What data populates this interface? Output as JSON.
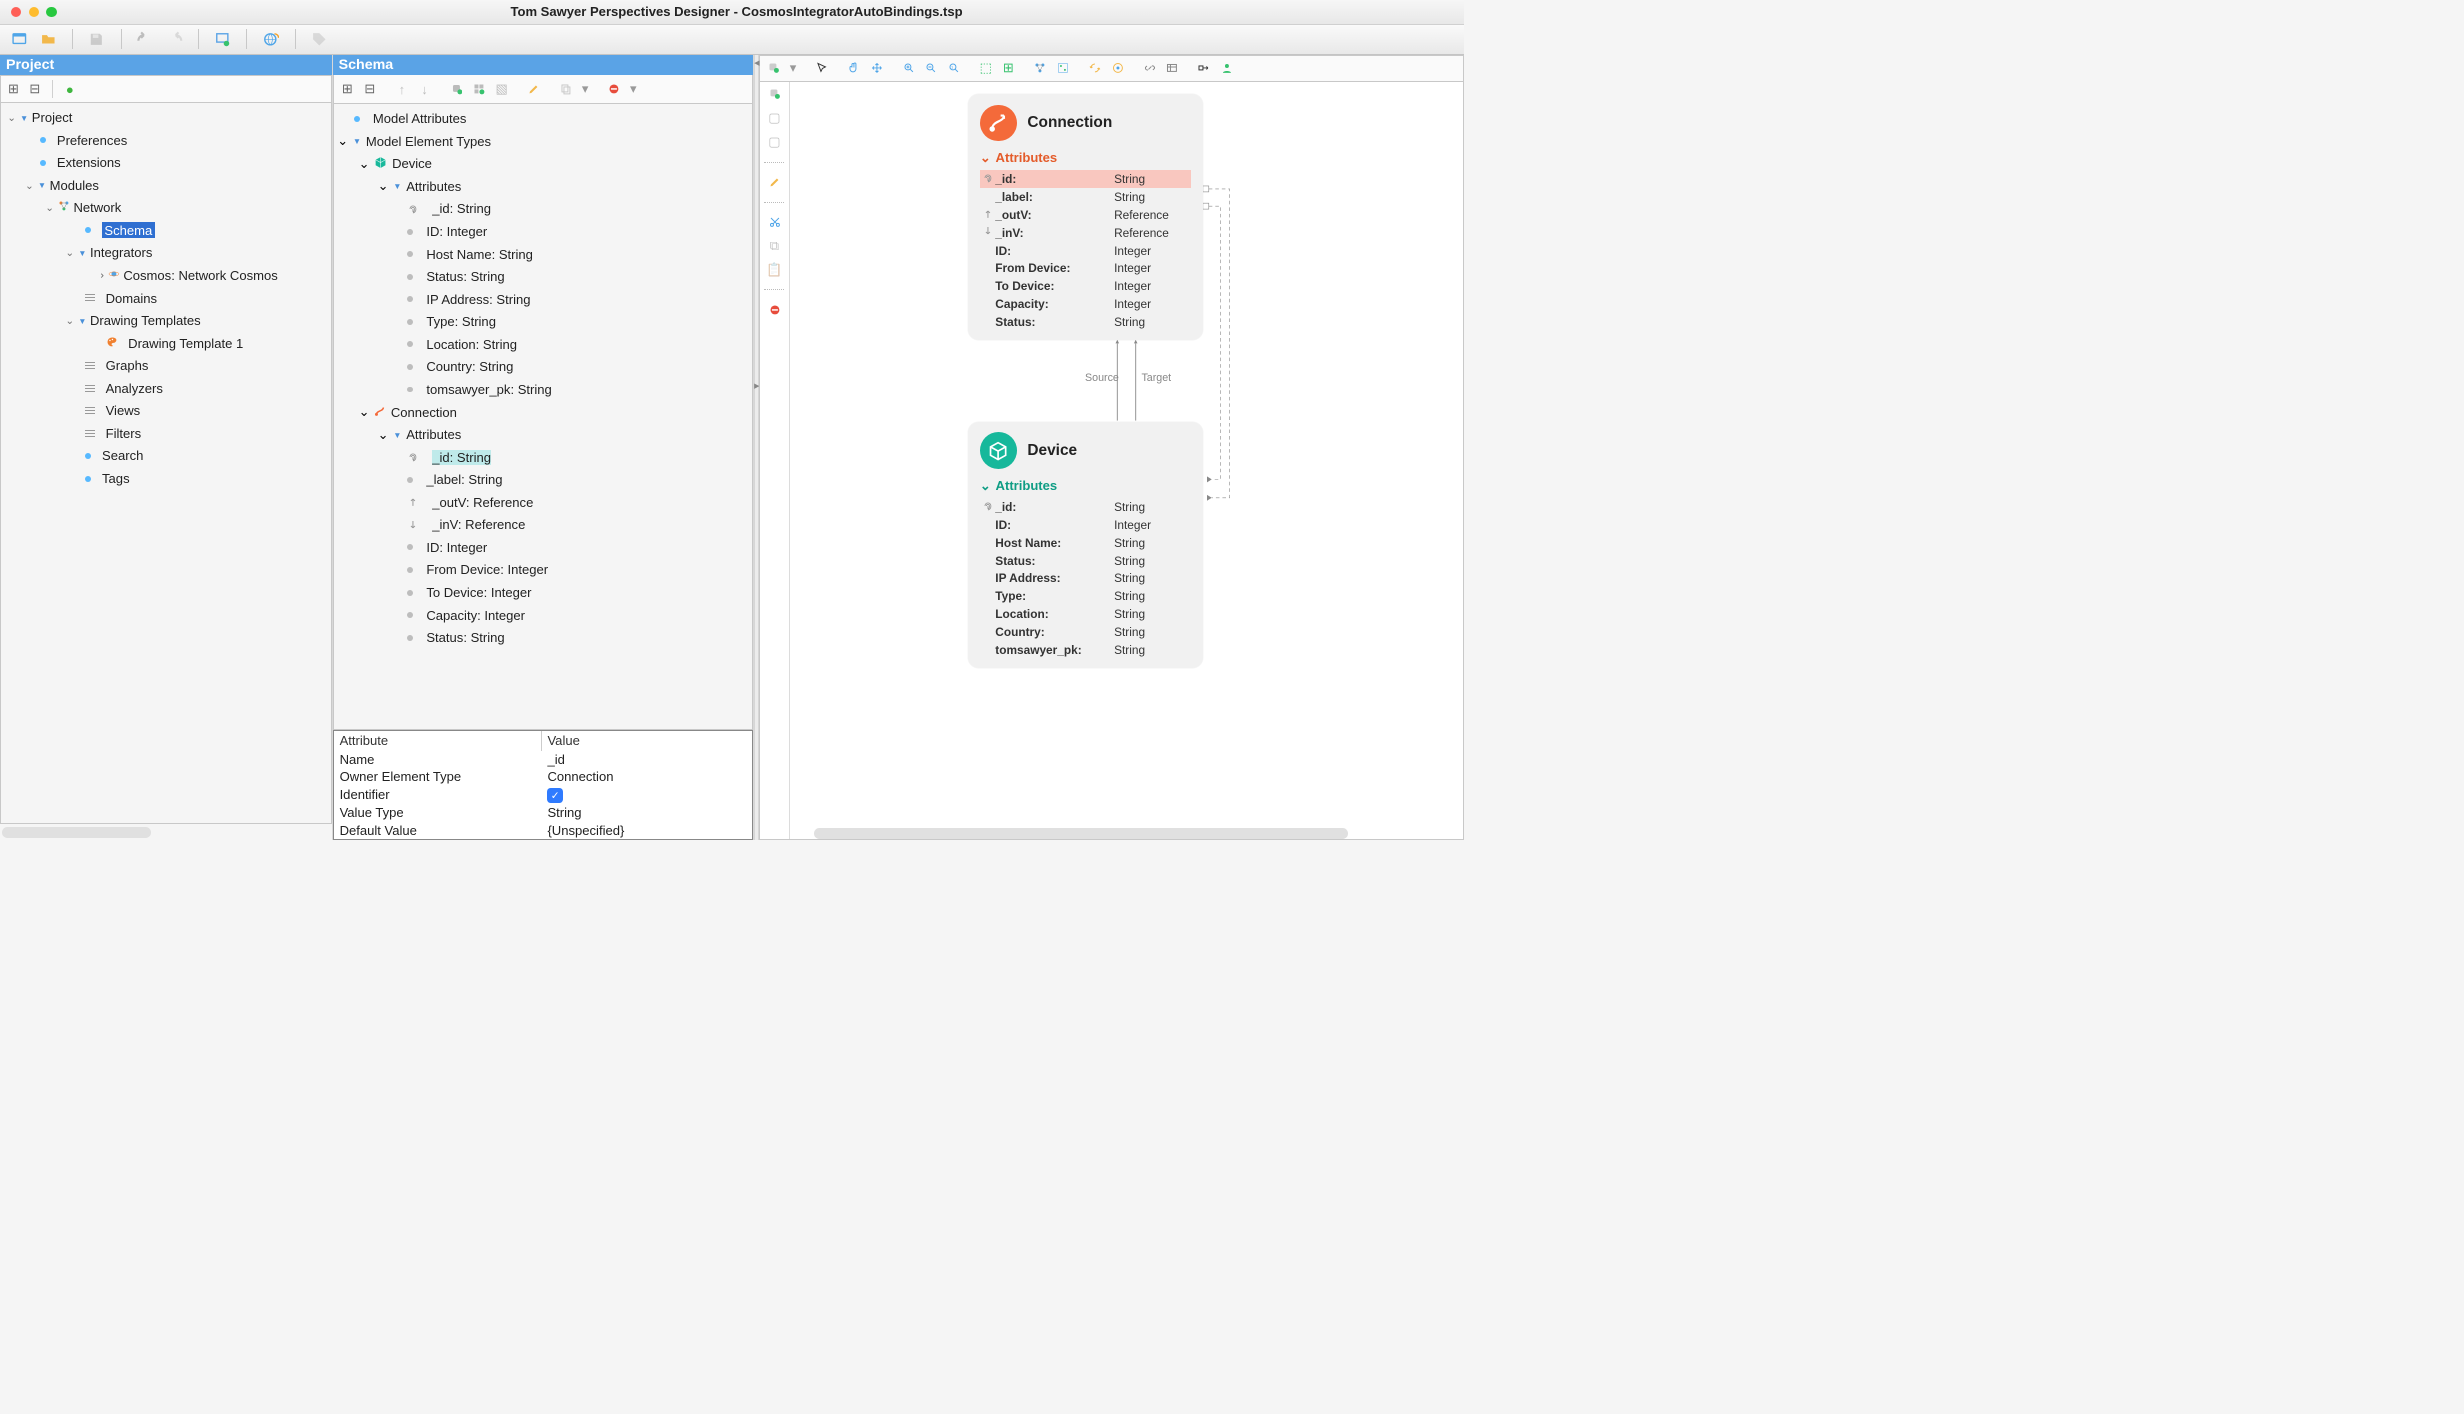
{
  "window": {
    "title": "Tom Sawyer Perspectives Designer - CosmosIntegratorAutoBindings.tsp"
  },
  "panels": {
    "project": "Project",
    "schema": "Schema"
  },
  "project_tree": {
    "root": "Project",
    "preferences": "Preferences",
    "extensions": "Extensions",
    "modules": "Modules",
    "network": "Network",
    "schema": "Schema",
    "integrators": "Integrators",
    "cosmos_integrator": "Cosmos: Network Cosmos",
    "domains": "Domains",
    "drawing_templates": "Drawing Templates",
    "drawing_template_1": "Drawing Template 1",
    "graphs": "Graphs",
    "analyzers": "Analyzers",
    "views": "Views",
    "filters": "Filters",
    "search": "Search",
    "tags": "Tags"
  },
  "schema_tree": {
    "model_attributes": "Model Attributes",
    "model_element_types": "Model Element Types",
    "device": "Device",
    "connection": "Connection",
    "attributes_label": "Attributes",
    "device_attrs": [
      "_id: String",
      "ID: Integer",
      "Host Name: String",
      "Status: String",
      "IP Address: String",
      "Type: String",
      "Location: String",
      "Country: String",
      "tomsawyer_pk: String"
    ],
    "connection_attrs": [
      "_id: String",
      "_label: String",
      "_outV: Reference",
      "_inV: Reference",
      "ID: Integer",
      "From Device: Integer",
      "To Device: Integer",
      "Capacity: Integer",
      "Status: String"
    ],
    "selected_conn_attr_index": 0
  },
  "properties": {
    "headers": {
      "attr": "Attribute",
      "value": "Value"
    },
    "rows": {
      "name_k": "Name",
      "name_v": "_id",
      "owner_k": "Owner Element Type",
      "owner_v": "Connection",
      "identifier_k": "Identifier",
      "vtype_k": "Value Type",
      "vtype_v": "String",
      "default_k": "Default Value",
      "default_v": "{Unspecified}"
    }
  },
  "cards": {
    "connection": {
      "title": "Connection",
      "attr_header": "Attributes",
      "attrs": [
        {
          "k": "_id:",
          "v": "String",
          "icon": "fp",
          "hl": true
        },
        {
          "k": "_label:",
          "v": "String",
          "icon": "dot"
        },
        {
          "k": "_outV:",
          "v": "Reference",
          "icon": "out"
        },
        {
          "k": "_inV:",
          "v": "Reference",
          "icon": "in"
        },
        {
          "k": "ID:",
          "v": "Integer",
          "icon": "dot"
        },
        {
          "k": "From Device:",
          "v": "Integer",
          "icon": "dot"
        },
        {
          "k": "To Device:",
          "v": "Integer",
          "icon": "dot"
        },
        {
          "k": "Capacity:",
          "v": "Integer",
          "icon": "dot"
        },
        {
          "k": "Status:",
          "v": "String",
          "icon": "dot"
        }
      ]
    },
    "device": {
      "title": "Device",
      "attr_header": "Attributes",
      "attrs": [
        {
          "k": "_id:",
          "v": "String",
          "icon": "fp"
        },
        {
          "k": "ID:",
          "v": "Integer",
          "icon": "dot"
        },
        {
          "k": "Host Name:",
          "v": "String",
          "icon": "dot"
        },
        {
          "k": "Status:",
          "v": "String",
          "icon": "dot"
        },
        {
          "k": "IP Address:",
          "v": "String",
          "icon": "dot"
        },
        {
          "k": "Type:",
          "v": "String",
          "icon": "dot"
        },
        {
          "k": "Location:",
          "v": "String",
          "icon": "dot"
        },
        {
          "k": "Country:",
          "v": "String",
          "icon": "dot"
        },
        {
          "k": "tomsawyer_pk:",
          "v": "String",
          "icon": "dot"
        }
      ]
    },
    "edge_source": "Source",
    "edge_target": "Target"
  }
}
